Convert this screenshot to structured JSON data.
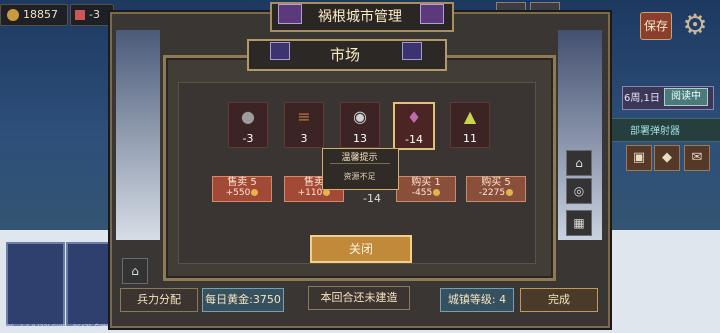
{
  "top": {
    "gold": "18857",
    "population": "-3",
    "save_label": "保存"
  },
  "city_window": {
    "title": "祸根城市管理",
    "bottom": {
      "troops_label": "兵力分配",
      "daily_gold_label": "每日黄金:",
      "daily_gold_value": "3750",
      "status_text": "本回合还未建造",
      "town_level_label": "城镇等级:",
      "town_level_value": "4",
      "finish_label": "完成"
    }
  },
  "right_panel": {
    "date_text": "6周,1日",
    "date_button": "阅读中",
    "deploy_label": "部署弹射器"
  },
  "market": {
    "title": "市场",
    "resources": [
      {
        "icon": "ore-icon",
        "value": "-3"
      },
      {
        "icon": "wood-icon",
        "value": "3"
      },
      {
        "icon": "mercury-icon",
        "value": "13"
      },
      {
        "icon": "crystal-icon",
        "value": "-14"
      },
      {
        "icon": "sulfur-icon",
        "value": "11"
      }
    ],
    "sell5": {
      "label": "售卖 5",
      "amount": "+550"
    },
    "sell1": {
      "label": "售卖",
      "amount": "+110"
    },
    "center_value": "-14",
    "buy1": {
      "label": "购买 1",
      "amount": "-455"
    },
    "buy5": {
      "label": "购买 5",
      "amount": "-2275"
    },
    "close_label": "关闭",
    "tooltip_title": "温馨提示",
    "tooltip_text": "资源不足"
  },
  "footer": {
    "version": "iOS - 1.1.0 (33)  GUID - 86475  自动存档"
  },
  "colors": {
    "accent_gold": "#c08a3a",
    "sell_red": "#a24a36",
    "panel_bg": "#433d37"
  }
}
